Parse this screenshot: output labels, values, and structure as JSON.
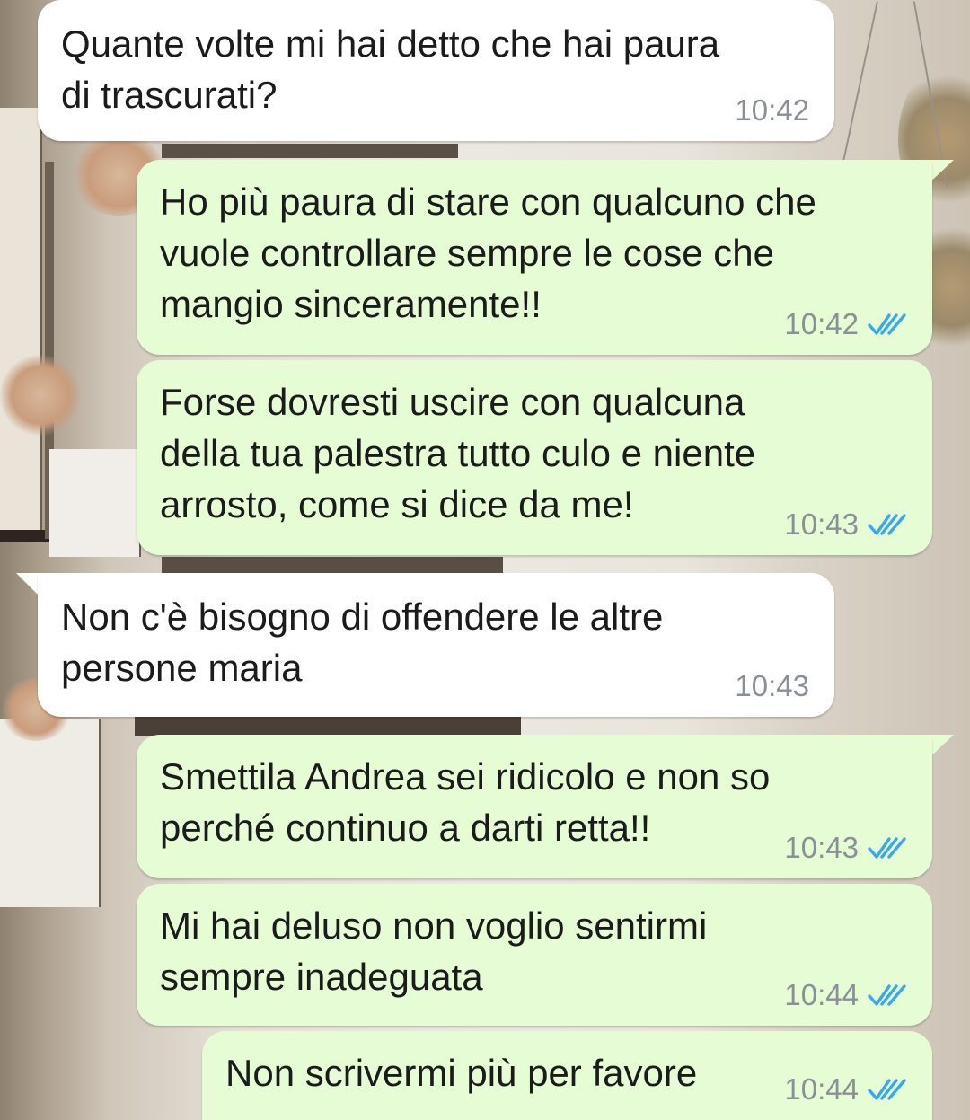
{
  "colors": {
    "incoming_bubble": "#ffffff",
    "outgoing_bubble": "#e5fcd5",
    "timestamp": "#8a9096",
    "read_receipt": "#3aa7f0"
  },
  "messages": [
    {
      "direction": "incoming",
      "text": "Quante volte mi hai detto che hai paura\ndi trascurati?",
      "time": "10:42",
      "read_icon": ""
    },
    {
      "direction": "outgoing",
      "text": "Ho più paura di stare con qualcuno che\nvuole controllare sempre le cose che\nmangio sinceramente!!",
      "time": "10:42",
      "read_icon": "double-check-icon"
    },
    {
      "direction": "outgoing",
      "text": "Forse dovresti uscire con qualcuna\ndella tua palestra tutto culo e niente\narrosto, come si dice da me!",
      "time": "10:43",
      "read_icon": "double-check-icon"
    },
    {
      "direction": "incoming",
      "text": "Non c'è bisogno di offendere le altre\npersone maria",
      "time": "10:43",
      "read_icon": ""
    },
    {
      "direction": "outgoing",
      "text": "Smettila Andrea sei ridicolo e non so\nperché continuo a darti retta!!",
      "time": "10:43",
      "read_icon": "double-check-icon"
    },
    {
      "direction": "outgoing",
      "text": "Mi hai deluso non voglio sentirmi\nsempre inadeguata",
      "time": "10:44",
      "read_icon": "double-check-icon"
    },
    {
      "direction": "outgoing",
      "text": "Non scrivermi più per favore",
      "time": "10:44",
      "read_icon": "double-check-icon"
    }
  ]
}
